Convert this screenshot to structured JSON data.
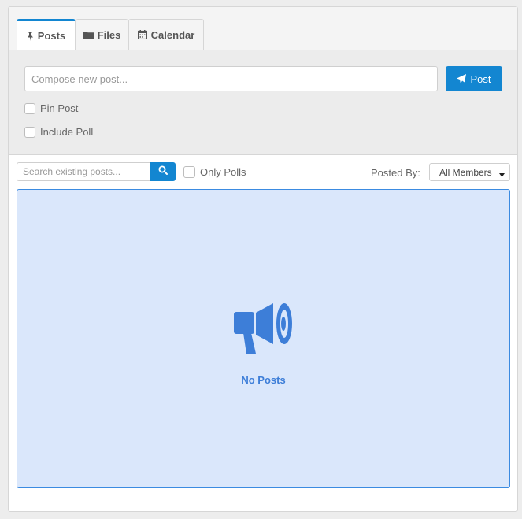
{
  "tabs": [
    {
      "label": "Posts",
      "icon": "pin-icon",
      "active": true
    },
    {
      "label": "Files",
      "icon": "folder-icon",
      "active": false
    },
    {
      "label": "Calendar",
      "icon": "calendar-icon",
      "active": false
    }
  ],
  "compose": {
    "placeholder": "Compose new post...",
    "post_label": "Post",
    "pin_label": "Pin Post",
    "poll_label": "Include Poll"
  },
  "filters": {
    "search_placeholder": "Search existing posts...",
    "only_polls_label": "Only Polls",
    "posted_by_label": "Posted By:",
    "posted_by_value": "All Members"
  },
  "empty_state": {
    "message": "No Posts",
    "icon": "megaphone-icon"
  },
  "colors": {
    "accent": "#1386d1",
    "empty_bg": "#dae7fb",
    "empty_fg": "#3d7ed8"
  }
}
